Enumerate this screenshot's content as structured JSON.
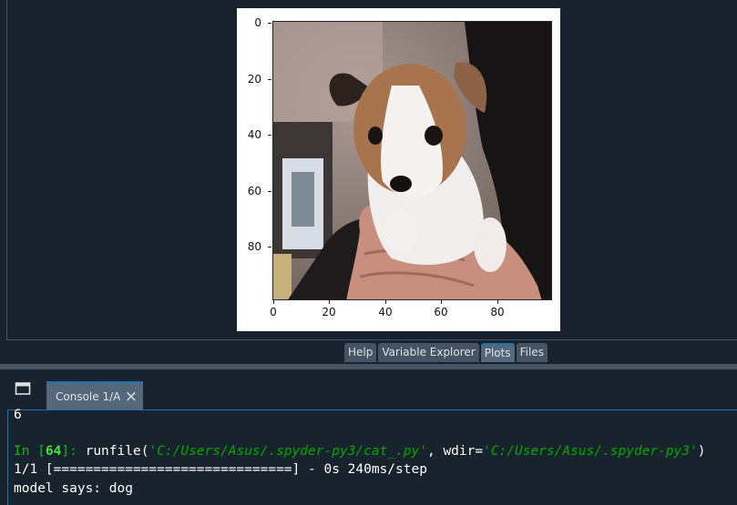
{
  "plot": {
    "yticks": [
      "0",
      "20",
      "40",
      "60",
      "80"
    ],
    "xticks": [
      "0",
      "20",
      "40",
      "60",
      "80"
    ]
  },
  "pane_tabs": [
    {
      "label": "Help",
      "active": false
    },
    {
      "label": "Variable Explorer",
      "active": false
    },
    {
      "label": "Plots",
      "active": true
    },
    {
      "label": "Files",
      "active": false
    }
  ],
  "console": {
    "tab_label": "Console 1/A",
    "close_icon": "×",
    "partial_line": "6",
    "prompt_prefix": "In [",
    "prompt_number": "64",
    "prompt_suffix": "]: ",
    "cmd_func": "runfile(",
    "cmd_arg1": "'C:/Users/Asus/.spyder-py3/cat_.py'",
    "cmd_sep": ", wdir=",
    "cmd_arg2": "'C:/Users/Asus/.spyder-py3'",
    "cmd_close": ")",
    "progress_line": "1/1 [==============================] - 0s 240ms/step",
    "result_line": "model says: dog"
  }
}
